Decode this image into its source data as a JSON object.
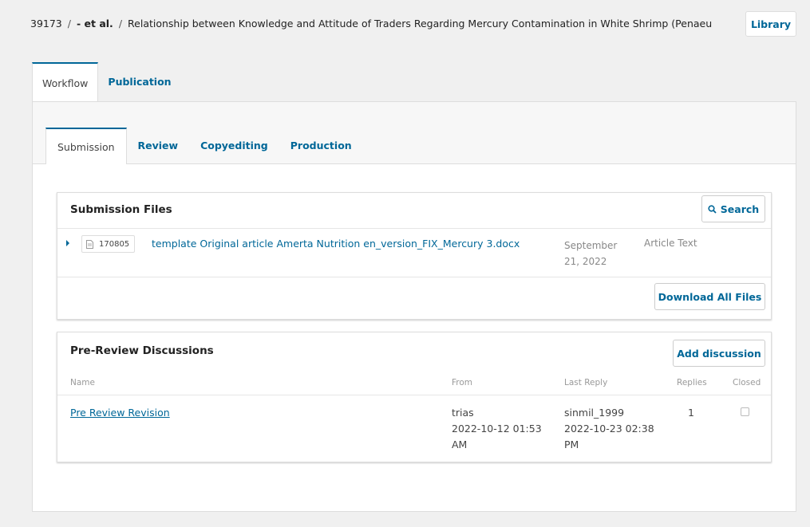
{
  "breadcrumb": {
    "id": "39173",
    "author": "- et al.",
    "title": "Relationship between Knowledge and Attitude of Traders Regarding Mercury Contamination in White Shrimp (Penaeu"
  },
  "header": {
    "library_label": "Library"
  },
  "tabs": {
    "workflow": "Workflow",
    "publication": "Publication"
  },
  "stage_tabs": {
    "submission": "Submission",
    "review": "Review",
    "copyediting": "Copyediting",
    "production": "Production"
  },
  "submission_files": {
    "title": "Submission Files",
    "search_label": "Search",
    "download_label": "Download All Files",
    "files": [
      {
        "id": "170805",
        "name": "template Original article Amerta Nutrition en_version_FIX_Mercury 3.docx",
        "date": "September 21, 2022",
        "type": "Article Text"
      }
    ]
  },
  "discussions": {
    "title": "Pre-Review Discussions",
    "add_label": "Add discussion",
    "columns": {
      "name": "Name",
      "from": "From",
      "last_reply": "Last Reply",
      "replies": "Replies",
      "closed": "Closed"
    },
    "rows": [
      {
        "name": "Pre Review Revision",
        "from_user": "trias",
        "from_date": "2022-10-12 01:53 AM",
        "reply_user": "sinmil_1999",
        "reply_date": "2022-10-23 02:38 PM",
        "replies": "1",
        "closed": false
      }
    ]
  },
  "colors": {
    "accent": "#006798",
    "background": "#f0f0f0",
    "muted": "#888888"
  },
  "icons": {
    "search": "search-icon",
    "file": "file-icon",
    "expand": "caret-right-icon"
  }
}
